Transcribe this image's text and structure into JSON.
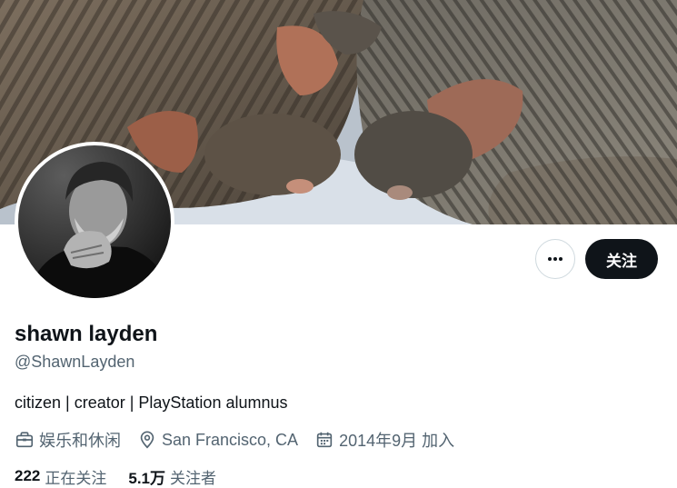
{
  "profile": {
    "name": "shawn layden",
    "handle": "@ShawnLayden",
    "bio": "citizen | creator | PlayStation alumnus",
    "category": "娱乐和休闲",
    "location": "San Francisco, CA",
    "joined": "2014年9月 加入"
  },
  "actions": {
    "follow_label": "关注",
    "more_icon": "more-icon"
  },
  "stats": {
    "following_count": "222",
    "following_label": "正在关注",
    "followers_count": "5.1万",
    "followers_label": "关注者"
  },
  "colors": {
    "primary_text": "#0f1419",
    "secondary_text": "#536471",
    "button_dark": "#0f1419",
    "border": "#cfd9de"
  },
  "icons": {
    "category": "briefcase-icon",
    "location": "location-pin-icon",
    "joined": "calendar-icon"
  }
}
